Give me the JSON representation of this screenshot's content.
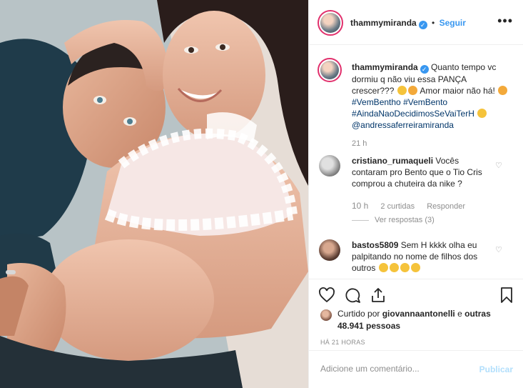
{
  "post": {
    "username": "thammymiranda",
    "verified_mark": "✓",
    "separator": "•",
    "follow_label": "Seguir",
    "more_label": "•••"
  },
  "caption": {
    "username": "thammymiranda",
    "text_1": "Quanto tempo vc dormiu q não viu essa PANÇA crescer???",
    "text_2": "Amor maior não há!",
    "tag_1": "#VemBentho",
    "tag_2": "#VemBento",
    "tag_3": "#AindaNaoDecidimosSeVaiTerH",
    "mention": "@andressaferreiramiranda",
    "time": "21 h"
  },
  "comments": [
    {
      "username": "cristiano_rumaqueli",
      "text": "Vocês contaram pro Bento que o Tio Cris comprou a chuteira da nike ?",
      "time": "10 h",
      "likes": "2 curtidas",
      "reply": "Responder",
      "view_replies": "Ver respostas (3)"
    },
    {
      "username": "bastos5809",
      "text": "Sem H kkkk olha eu palpitando no nome de filhos dos outros",
      "emoji_count": "4"
    }
  ],
  "likes": {
    "prefix": "Curtido por",
    "user": "giovannaantonelli",
    "and": "e",
    "others": "outras 48.941 pessoas"
  },
  "timestamp": "HÁ 21 HORAS",
  "add_comment": {
    "placeholder": "Adicione um comentário...",
    "publish_label": "Publicar"
  },
  "icons": {
    "like": "heart-icon",
    "comment": "comment-icon",
    "share": "share-icon",
    "save": "bookmark-icon"
  },
  "colors": {
    "link": "#3897f0",
    "hashtag": "#003569",
    "story_ring": "#e1306c",
    "publish_disabled": "#b2dffc"
  }
}
